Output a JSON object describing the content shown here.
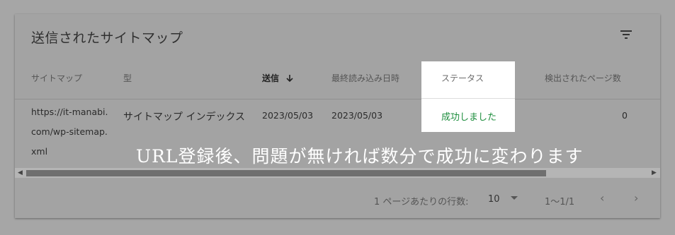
{
  "card": {
    "title": "送信されたサイトマップ",
    "filter_icon": "filter-icon"
  },
  "table": {
    "headers": {
      "sitemap": "サイトマップ",
      "type": "型",
      "submitted": "送信",
      "last_read": "最終読み込み日時",
      "status": "ステータス",
      "discovered": "検出されたページ数"
    },
    "sort_icon": "arrow-down-icon",
    "rows": [
      {
        "sitemap": "https://it-manabi.com/wp-sitemap.xml",
        "type": "サイトマップ インデックス",
        "submitted": "2023/05/03",
        "last_read": "2023/05/03",
        "status": "成功しました",
        "discovered": "0"
      }
    ]
  },
  "footer": {
    "rows_per_page_label": "1 ページあたりの行数:",
    "rows_per_page_value": "10",
    "range": "1〜1/1"
  },
  "annotation": "URL登録後、問題が無ければ数分で成功に変わります",
  "colors": {
    "success": "#1e8e3e",
    "overlay": "#a3a3a3"
  }
}
